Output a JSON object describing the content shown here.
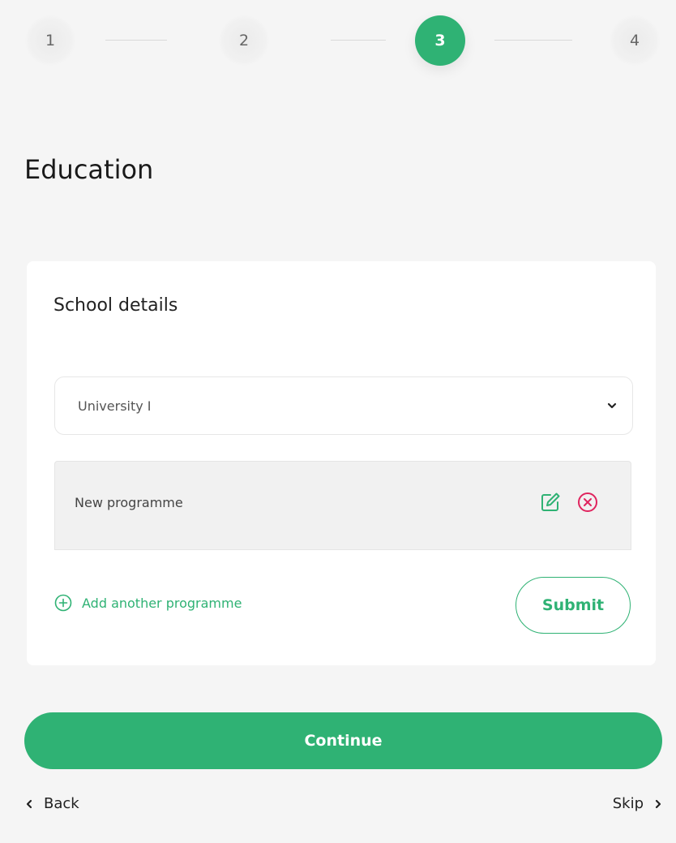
{
  "stepper": {
    "steps": [
      {
        "label": "1",
        "state": "inactive"
      },
      {
        "label": "2",
        "state": "inactive"
      },
      {
        "label": "3",
        "state": "active"
      },
      {
        "label": "4",
        "state": "inactive"
      }
    ]
  },
  "page": {
    "title": "Education"
  },
  "card": {
    "title": "School details",
    "school_select": {
      "value": "University I"
    },
    "programmes": [
      {
        "name": "New programme"
      }
    ],
    "add_programme_label": "Add another programme",
    "submit_label": "Submit"
  },
  "footer": {
    "continue_label": "Continue",
    "back_label": "Back",
    "skip_label": "Skip"
  },
  "colors": {
    "accent": "#2fb274",
    "danger": "#e0245e",
    "background": "#f5f5f5"
  },
  "icons": {
    "edit": "edit-icon",
    "remove": "remove-circle-icon",
    "add": "plus-circle-icon",
    "dropdown": "chevron-down-icon",
    "back": "chevron-left-icon",
    "skip": "chevron-right-icon"
  }
}
